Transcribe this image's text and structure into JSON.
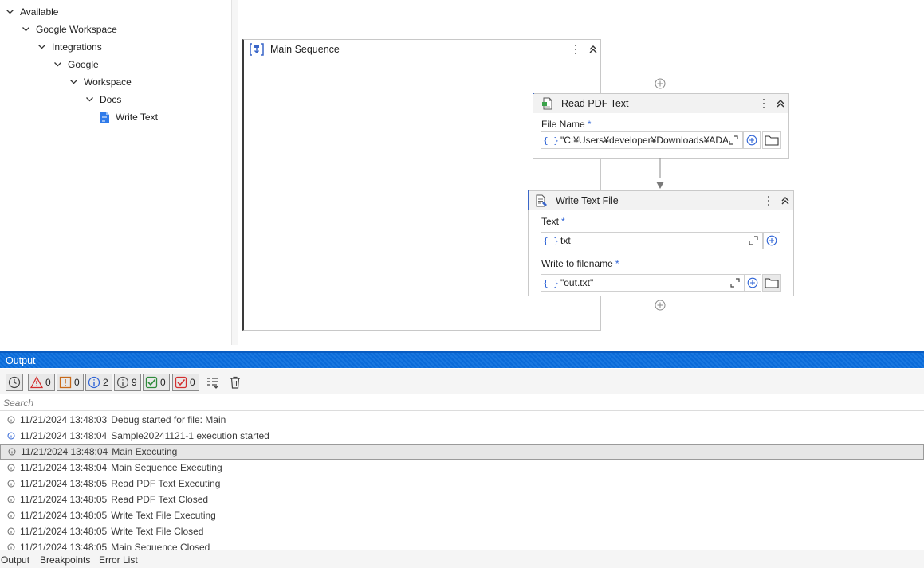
{
  "tree": {
    "items": [
      {
        "label": "Available",
        "level": 0,
        "type": "folder"
      },
      {
        "label": "Google Workspace",
        "level": 1,
        "type": "folder"
      },
      {
        "label": "Integrations",
        "level": 2,
        "type": "folder"
      },
      {
        "label": "Google",
        "level": 3,
        "type": "folder"
      },
      {
        "label": "Workspace",
        "level": 4,
        "type": "folder"
      },
      {
        "label": "Docs",
        "level": 5,
        "type": "folder"
      },
      {
        "label": "Write Text",
        "level": 6,
        "type": "activity"
      }
    ]
  },
  "designer": {
    "main_sequence": {
      "title": "Main Sequence"
    },
    "read_pdf": {
      "title": "Read PDF Text",
      "file_name_label": "File Name",
      "required_mark": "*",
      "file_name_value": "\"C:¥Users¥developer¥Downloads¥ADA"
    },
    "write_text_file": {
      "title": "Write Text File",
      "text_label": "Text",
      "text_value": "txt",
      "filename_label": "Write to filename",
      "filename_value": "\"out.txt\"",
      "required_mark": "*"
    },
    "brace_symbol": "{ }"
  },
  "output": {
    "title": "Output",
    "filters": {
      "errors": "0",
      "warnings": "0",
      "info": "2",
      "trace": "9",
      "success": "0",
      "failed": "0"
    },
    "search_placeholder": "Search",
    "log": [
      {
        "time": "11/21/2024 13:48:03",
        "message": "Debug started for file: Main",
        "kind": "trace"
      },
      {
        "time": "11/21/2024 13:48:04",
        "message": "Sample20241121-1 execution started",
        "kind": "info"
      },
      {
        "time": "11/21/2024 13:48:04",
        "message": "Main Executing",
        "kind": "trace",
        "selected": true
      },
      {
        "time": "11/21/2024 13:48:04",
        "message": "Main Sequence Executing",
        "kind": "trace"
      },
      {
        "time": "11/21/2024 13:48:05",
        "message": "Read PDF Text Executing",
        "kind": "trace"
      },
      {
        "time": "11/21/2024 13:48:05",
        "message": "Read PDF Text Closed",
        "kind": "trace"
      },
      {
        "time": "11/21/2024 13:48:05",
        "message": "Write Text File Executing",
        "kind": "trace"
      },
      {
        "time": "11/21/2024 13:48:05",
        "message": "Write Text File Closed",
        "kind": "trace"
      },
      {
        "time": "11/21/2024 13:48:05",
        "message": "Main Sequence Closed",
        "kind": "trace"
      }
    ]
  },
  "bottom_tabs": [
    "Output",
    "Breakpoints",
    "Error List"
  ],
  "colors": {
    "accent_blue": "#0a6ad8",
    "required_blue": "#2f64d6",
    "error_red": "#d32f2f",
    "warning_orange": "#c86a1a",
    "success_green": "#2e8b3a"
  }
}
